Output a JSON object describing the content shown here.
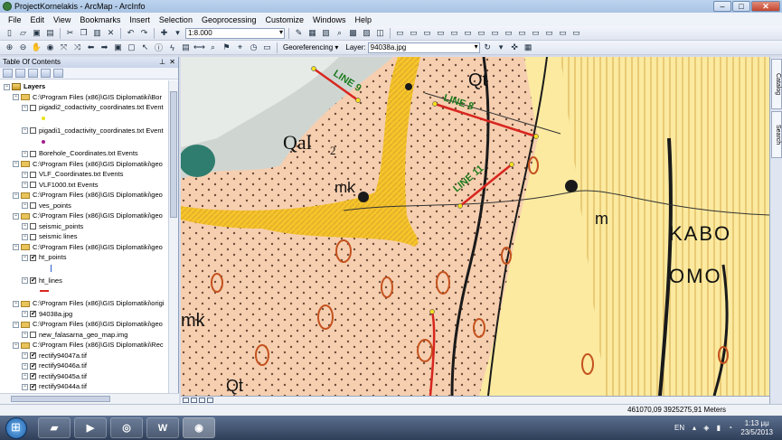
{
  "window": {
    "title": "ProjectKornelakis - ArcMap - ArcInfo",
    "min": "–",
    "max": "□",
    "close": "✕"
  },
  "menu": [
    "File",
    "Edit",
    "View",
    "Bookmarks",
    "Insert",
    "Selection",
    "Geoprocessing",
    "Customize",
    "Windows",
    "Help"
  ],
  "toolbar": {
    "scale": "1:8.000",
    "georeferencing_label": "Georeferencing ▾",
    "layer_label": "Layer:",
    "layer_value": "94038a.jpg"
  },
  "toc": {
    "title": "Table Of Contents",
    "pin": "⊥",
    "close": "✕",
    "layers_label": "Layers",
    "rows": [
      {
        "indent": 0,
        "kind": "root",
        "label": "Layers"
      },
      {
        "indent": 1,
        "kind": "folder",
        "label": "C:\\Program Files (x86)\\GIS Diplomatiki\\Bor"
      },
      {
        "indent": 2,
        "kind": "layer",
        "checked": false,
        "label": "pigadi2_codactivity_coordinates.txt Event"
      },
      {
        "indent": 2,
        "kind": "layer",
        "checked": false,
        "label": "pigadi1_codactivity_coordinates.txt Event"
      },
      {
        "indent": 2,
        "kind": "layer",
        "checked": false,
        "label": "Borehole_Coordinates.txt Events"
      },
      {
        "indent": 1,
        "kind": "folder",
        "label": "C:\\Program Files (x86)\\GIS Diplomatiki\\geo"
      },
      {
        "indent": 2,
        "kind": "layer",
        "checked": false,
        "label": "VLF_Coordinates.txt Events"
      },
      {
        "indent": 2,
        "kind": "layer",
        "checked": false,
        "label": "VLF1000.txt Events"
      },
      {
        "indent": 1,
        "kind": "folder",
        "label": "C:\\Program Files (x86)\\GIS Diplomatiki\\geo"
      },
      {
        "indent": 2,
        "kind": "layer",
        "checked": false,
        "label": "ves_points"
      },
      {
        "indent": 1,
        "kind": "folder",
        "label": "C:\\Program Files (x86)\\GIS Diplomatiki\\geo"
      },
      {
        "indent": 2,
        "kind": "layer",
        "checked": false,
        "label": "seismic_points"
      },
      {
        "indent": 2,
        "kind": "layer",
        "checked": false,
        "label": "seismic lines"
      },
      {
        "indent": 1,
        "kind": "folder",
        "label": "C:\\Program Files (x86)\\GIS Diplomatiki\\geo"
      },
      {
        "indent": 2,
        "kind": "layer",
        "checked": true,
        "label": "ht_points"
      },
      {
        "indent": 2,
        "kind": "layer",
        "checked": true,
        "label": "ht_lines"
      },
      {
        "indent": 1,
        "kind": "folder",
        "label": "C:\\Program Files (x86)\\GIS Diplomatiki\\origi"
      },
      {
        "indent": 2,
        "kind": "layer",
        "checked": true,
        "label": "94038a.jpg"
      },
      {
        "indent": 1,
        "kind": "folder",
        "label": "C:\\Program Files (x86)\\GIS Diplomatiki\\geo"
      },
      {
        "indent": 2,
        "kind": "layer",
        "checked": false,
        "label": "new_falasarna_geo_map.img"
      },
      {
        "indent": 1,
        "kind": "folder",
        "label": "C:\\Program Files (x86)\\GIS Diplomatiki\\Rec"
      },
      {
        "indent": 2,
        "kind": "layer",
        "checked": true,
        "label": "rectify94047a.tif"
      },
      {
        "indent": 2,
        "kind": "layer",
        "checked": true,
        "label": "rectify94046a.tif"
      },
      {
        "indent": 2,
        "kind": "layer",
        "checked": true,
        "label": "rectify94045a.tif"
      },
      {
        "indent": 2,
        "kind": "layer",
        "checked": true,
        "label": "rectify94044a.tif"
      },
      {
        "indent": 2,
        "kind": "layer",
        "checked": true,
        "label": "rectify94043a.tif"
      }
    ]
  },
  "map": {
    "labels": {
      "line9": "LINE 9",
      "line8": "LINE 8",
      "line11": "LINE 11",
      "qal": "Qal",
      "qal_sub": "2",
      "qt": "Qt",
      "qt2": "Qt",
      "mk": "mk",
      "mk2": "mk",
      "m": "m",
      "kabo": "KABO",
      "omo": "OMO"
    },
    "colors": {
      "survey_line": "#d8261f",
      "line_label": "#1d7a1d",
      "yellow": "#f5c52a",
      "salmon": "#f6cfb0",
      "pale_yellow": "#fbeaa0"
    }
  },
  "dock": {
    "catalog": "Catalog",
    "search": "Search"
  },
  "status": {
    "coords": "461070,09  3925275,91 Meters"
  },
  "taskbar": {
    "lang": "EN",
    "time": "1:13 μμ",
    "date": "23/5/2013"
  }
}
